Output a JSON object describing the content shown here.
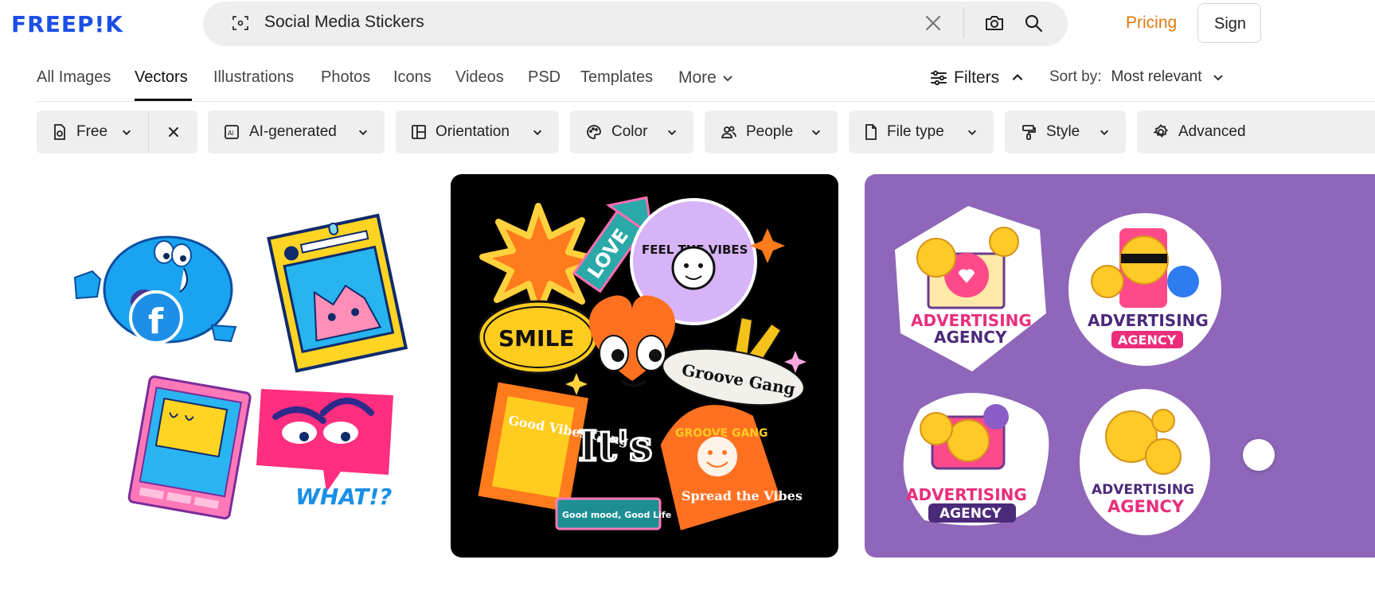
{
  "header": {
    "logo_text": "FREEP!K",
    "search": {
      "value": "Social Media Stickers"
    },
    "pricing_label": "Pricing",
    "signin_label": "Sign",
    "accent_color": "#e2780f",
    "brand_color": "#1c4fe6"
  },
  "tabs": [
    {
      "label": "All Images"
    },
    {
      "label": "Vectors",
      "active": true
    },
    {
      "label": "Illustrations"
    },
    {
      "label": "Photos"
    },
    {
      "label": "Icons"
    },
    {
      "label": "Videos"
    },
    {
      "label": "PSD"
    },
    {
      "label": "Templates"
    }
  ],
  "more_label": "More",
  "filters_label": "Filters",
  "sort": {
    "label": "Sort by:",
    "value": "Most relevant"
  },
  "chips": [
    {
      "label": "Free",
      "icon": "free-file-icon"
    },
    {
      "label": "AI-generated",
      "icon": "ai-icon"
    },
    {
      "label": "Orientation",
      "icon": "layout-icon"
    },
    {
      "label": "Color",
      "icon": "palette-icon"
    },
    {
      "label": "People",
      "icon": "people-icon"
    },
    {
      "label": "File type",
      "icon": "file-icon"
    },
    {
      "label": "Style",
      "icon": "brush-icon"
    },
    {
      "label": "Advanced",
      "icon": "gear-icon"
    }
  ],
  "results": {
    "card1": {
      "stickers": [
        "f",
        "WHAT!?"
      ]
    },
    "card2": {
      "stickers": [
        "LOVE",
        "FEEL THE VIBES",
        "SMILE",
        "Groove Gang",
        "Good Vibes Gang",
        "It's Ok",
        "Good mood, Good Life",
        "GROOVE GANG",
        "Spread the Vibes"
      ]
    },
    "card3": {
      "badges": [
        {
          "line1": "ADVERTISING",
          "line2": "AGENCY"
        },
        {
          "line1": "ADVERTISING",
          "line2": "AGENCY"
        },
        {
          "line1": "ADVERTISING",
          "line2": "AGENCY"
        },
        {
          "line1": "ADVERTISING",
          "line2": "AGENCY"
        }
      ]
    }
  }
}
